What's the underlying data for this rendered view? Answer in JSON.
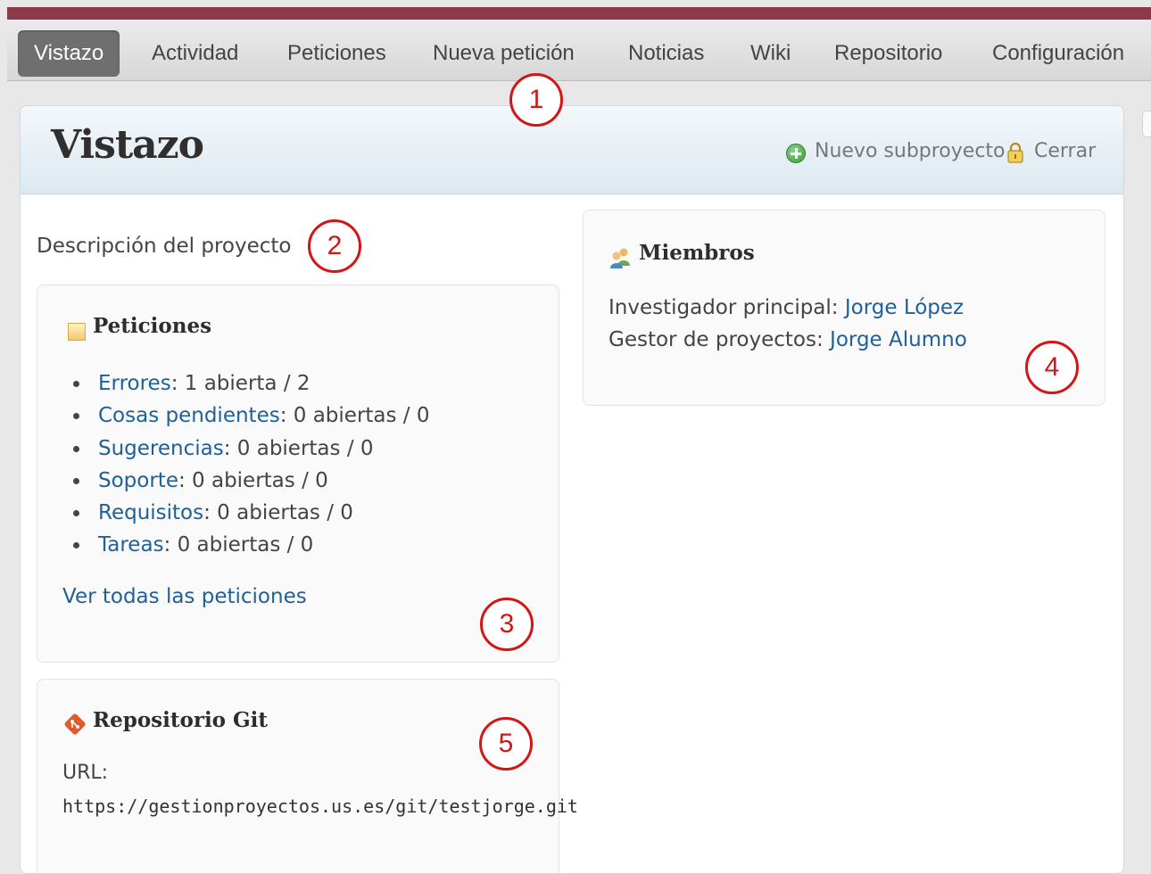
{
  "nav": {
    "tabs": [
      {
        "label": "Vistazo",
        "active": true
      },
      {
        "label": "Actividad"
      },
      {
        "label": "Peticiones"
      },
      {
        "label": "Nueva petición"
      },
      {
        "label": "Noticias"
      },
      {
        "label": "Wiki"
      },
      {
        "label": "Repositorio"
      },
      {
        "label": "Configuración"
      }
    ]
  },
  "header": {
    "title": "Vistazo",
    "new_subproject": "Nuevo subproyecto",
    "close": "Cerrar"
  },
  "description": "Descripción del proyecto",
  "issues": {
    "title": "Peticiones",
    "items": [
      {
        "tracker": "Errores",
        "counts": ": 1 abierta / 2"
      },
      {
        "tracker": "Cosas pendientes",
        "counts": ": 0 abiertas / 0"
      },
      {
        "tracker": "Sugerencias",
        "counts": ": 0 abiertas / 0"
      },
      {
        "tracker": "Soporte",
        "counts": ": 0 abiertas / 0"
      },
      {
        "tracker": "Requisitos",
        "counts": ": 0 abiertas / 0"
      },
      {
        "tracker": "Tareas",
        "counts": ": 0 abiertas / 0"
      }
    ],
    "view_all": "Ver todas las peticiones"
  },
  "members": {
    "title": "Miembros",
    "rows": [
      {
        "role": "Investigador principal: ",
        "name": "Jorge López"
      },
      {
        "role": "Gestor de proyectos: ",
        "name": "Jorge Alumno"
      }
    ]
  },
  "repository": {
    "title": "Repositorio Git",
    "url_label": "URL:",
    "url": "https://gestionproyectos.us.es/git/testjorge.git"
  },
  "callouts": [
    "1",
    "2",
    "3",
    "4",
    "5"
  ],
  "colors": {
    "top_bar": "#8a3a4b",
    "active_tab": "#6f6f6f",
    "link": "#1f5f9a",
    "callout": "#d41515"
  }
}
